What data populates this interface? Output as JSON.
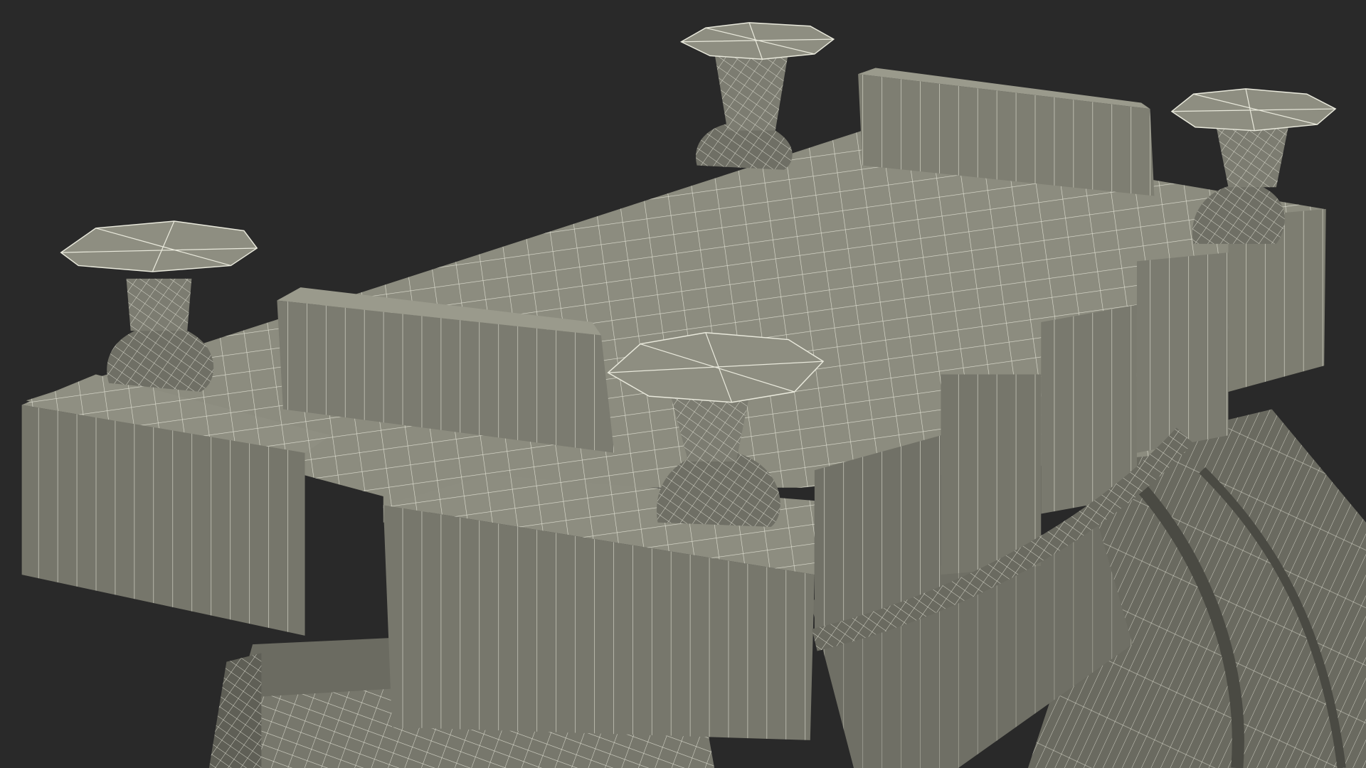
{
  "image": {
    "subject": "wireframe-render",
    "colors": {
      "background": "#292929",
      "surface_top": "#8c8c7f",
      "surface_side": "#75756a",
      "surface_dark": "#5f5f56",
      "wire": "#e9e9dc"
    }
  }
}
